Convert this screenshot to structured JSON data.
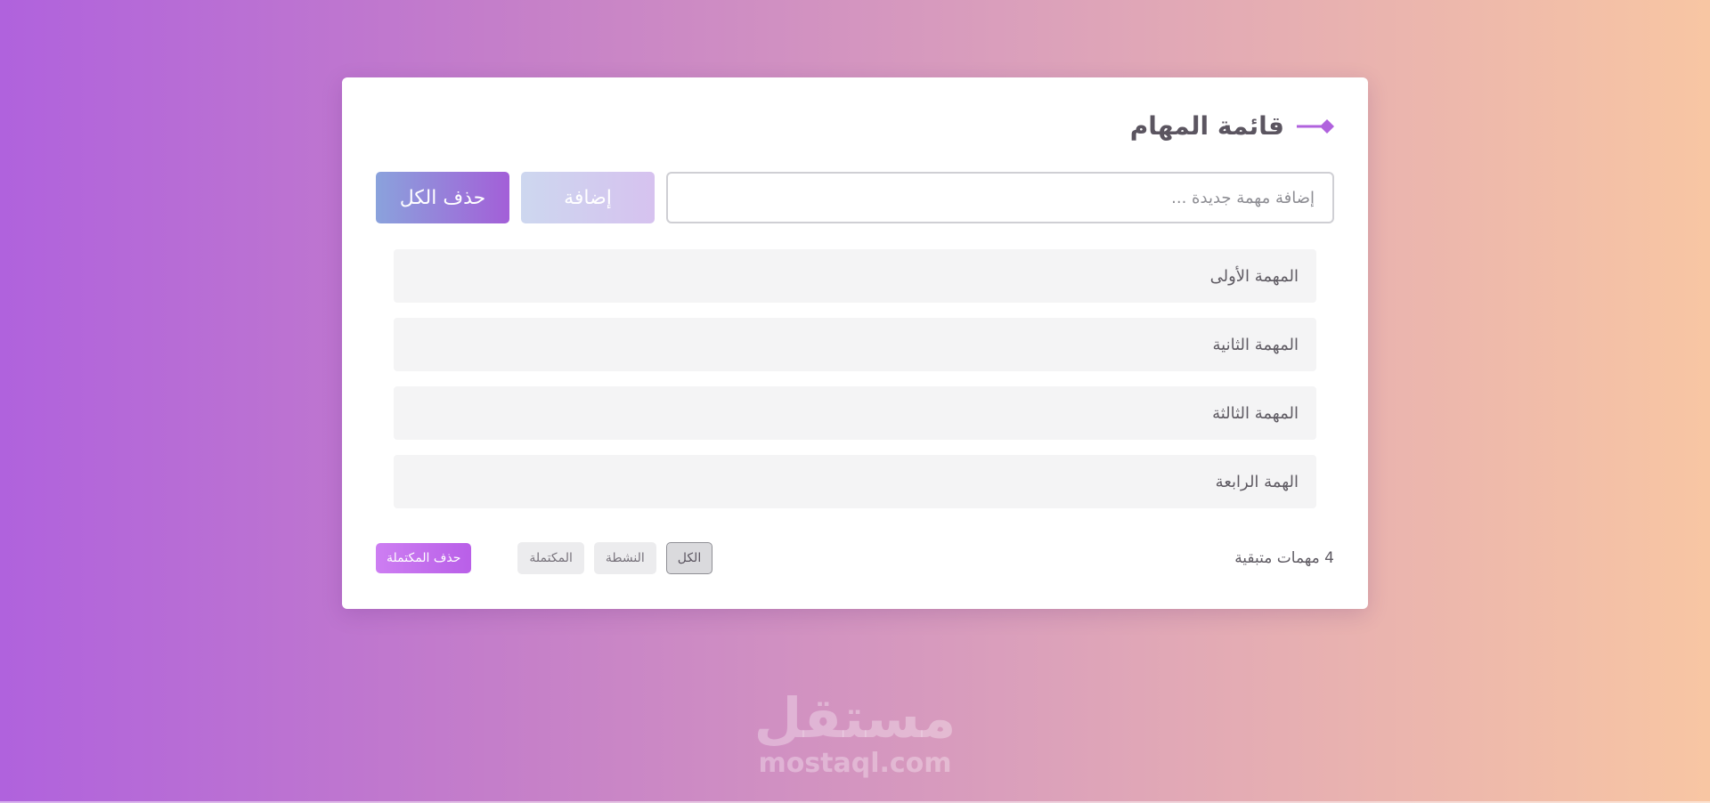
{
  "header": {
    "title": "قائمة المهام",
    "icon": "pin-icon",
    "accent_color": "#b062dd"
  },
  "input": {
    "placeholder": "إضافة مهمة جديدة ...",
    "value": ""
  },
  "buttons": {
    "add_label": "إضافة",
    "clear_all_label": "حذف الكل"
  },
  "tasks": [
    {
      "label": "المهمة الأولى"
    },
    {
      "label": "المهمة الثانية"
    },
    {
      "label": "المهمة الثالثة"
    },
    {
      "label": "الهمة الرابعة"
    }
  ],
  "footer": {
    "remaining": "4 مهمات متبقية",
    "filters": [
      {
        "label": "الكل",
        "active": true
      },
      {
        "label": "النشطة",
        "active": false
      },
      {
        "label": "المكتملة",
        "active": false
      }
    ],
    "clear_completed_label": "حذف المكتملة"
  },
  "watermark": {
    "logo_text": "مستقل",
    "url": "mostaql.com"
  }
}
